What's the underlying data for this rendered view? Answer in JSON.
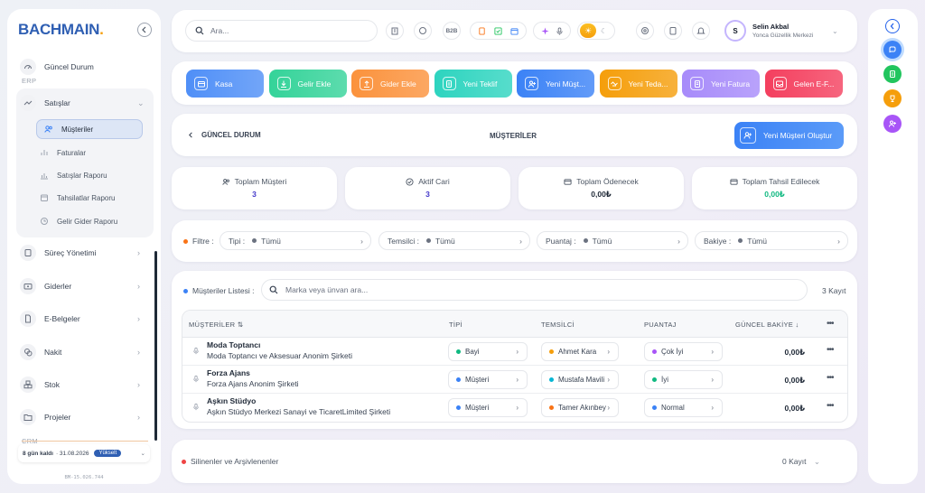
{
  "sidebar": {
    "logo": "BACHMAIN",
    "logo_dot": ".",
    "dashboard": "Güncel Durum",
    "section_erp": "ERP",
    "sales": "Satışlar",
    "sub_items": [
      "Müşteriler",
      "Faturalar",
      "Satışlar Raporu",
      "Tahsilatlar Raporu",
      "Gelir Gider Raporu"
    ],
    "items": [
      "Süreç Yönetimi",
      "Giderler",
      "E-Belgeler",
      "Nakit",
      "Stok",
      "Projeler"
    ],
    "section_crm": "CRM",
    "trial": {
      "days": "8 gün kaldı",
      "date": "· 31.08.2026",
      "upgrade": "Yükselt"
    },
    "version": "BM-15.026.744"
  },
  "topbar": {
    "search_placeholder": "Ara...",
    "b2b": "B2B",
    "user_initial": "S",
    "user_name": "Selin Akbal",
    "user_org": "Yonca Güzellik Merkezi"
  },
  "quick_actions": [
    {
      "label": "Kasa",
      "icon": "wallet-icon",
      "color": "#4f8ff7"
    },
    {
      "label": "Gelir Ekle",
      "icon": "download-icon",
      "color": "#34d399"
    },
    {
      "label": "Gider Ekle",
      "icon": "upload-icon",
      "color": "#fb923c"
    },
    {
      "label": "Yeni Teklif",
      "icon": "document-icon",
      "color": "#2dd4bf"
    },
    {
      "label": "Yeni Müşt...",
      "icon": "user-plus-icon",
      "color": "#3b82f6"
    },
    {
      "label": "Yeni Teda...",
      "icon": "handshake-icon",
      "color": "#f59e0b"
    },
    {
      "label": "Yeni Fatura",
      "icon": "invoice-icon",
      "color": "#a78bfa"
    },
    {
      "label": "Gelen E-F...",
      "icon": "inbox-icon",
      "color": "#f43f5e"
    }
  ],
  "page": {
    "back_label": "GÜNCEL DURUM",
    "title": "MÜŞTERİLER",
    "new_button": "Yeni Müşteri Oluştur"
  },
  "stats": [
    {
      "label": "Toplam Müşteri",
      "value": "3",
      "color": "#4338ca"
    },
    {
      "label": "Aktif Cari",
      "value": "3",
      "color": "#4338ca"
    },
    {
      "label": "Toplam Ödenecek",
      "value": "0,00₺",
      "color": "#1f2937"
    },
    {
      "label": "Toplam Tahsil Edilecek",
      "value": "0,00₺",
      "color": "#10b981"
    }
  ],
  "filters": {
    "label": "Filtre :",
    "chips": [
      {
        "label": "Tipi :",
        "value": "Tümü"
      },
      {
        "label": "Temsilci :",
        "value": "Tümü"
      },
      {
        "label": "Puantaj :",
        "value": "Tümü"
      },
      {
        "label": "Bakiye :",
        "value": "Tümü"
      }
    ]
  },
  "table": {
    "list_label": "Müşteriler Listesi :",
    "search_placeholder": "Marka veya ünvan ara...",
    "count": "3 Kayıt",
    "headers": {
      "name": "MÜŞTERİLER ⇅",
      "type": "TİPİ",
      "rep": "TEMSİLCİ",
      "score": "PUANTAJ",
      "balance": "GÜNCEL BAKİYE ↓",
      "more": "•••"
    },
    "rows": [
      {
        "name": "Moda Toptancı",
        "title": "Moda Toptancı ve Aksesuar Anonim Şirketi",
        "type": "Bayi",
        "type_color": "#10b981",
        "rep": "Ahmet Kara",
        "rep_color": "#f59e0b",
        "score": "Çok İyi",
        "score_color": "#a855f7",
        "balance": "0,00₺"
      },
      {
        "name": "Forza Ajans",
        "title": "Forza Ajans Anonim Şirketi",
        "type": "Müşteri",
        "type_color": "#3b82f6",
        "rep": "Mustafa Mavili",
        "rep_color": "#06b6d4",
        "score": "İyi",
        "score_color": "#10b981",
        "balance": "0,00₺"
      },
      {
        "name": "Aşkın Stüdyo",
        "title": "Aşkın Stüdyo Merkezi Sanayi ve TicaretLimited Şirketi",
        "type": "Müşteri",
        "type_color": "#3b82f6",
        "rep": "Tamer Akınbey",
        "rep_color": "#f97316",
        "score": "Normal",
        "score_color": "#3b82f6",
        "balance": "0,00₺"
      }
    ]
  },
  "archive": {
    "label": "Silinenler ve Arşivlenenler",
    "count": "0 Kayıt"
  },
  "rail_icons": [
    {
      "icon": "chevron-left-icon",
      "color": "#2563eb"
    },
    {
      "icon": "chat-icon",
      "color": "#3b82f6"
    },
    {
      "icon": "document-icon",
      "color": "#22c55e"
    },
    {
      "icon": "trophy-icon",
      "color": "#f59e0b"
    },
    {
      "icon": "user-plus-icon",
      "color": "#a855f7"
    }
  ]
}
